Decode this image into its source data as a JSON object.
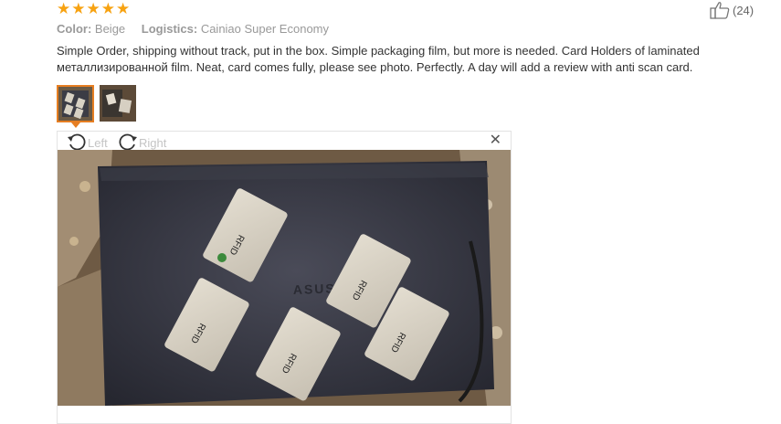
{
  "rating": {
    "stars": 5,
    "max": 5
  },
  "likes": {
    "count_text": "(24)",
    "icon": "thumbs-up-icon"
  },
  "meta": {
    "color_label": "Color:",
    "color_value": "Beige",
    "logistics_label": "Logistics:",
    "logistics_value": "Cainiao Super Economy"
  },
  "review": {
    "text": "Simple Order, shipping without track, put in the box. Simple packaging film, but more is needed. Card Holders of laminated металлизированной film. Neat, card comes fully, please see photo. Perfectly. A day will add a review with anti scan card."
  },
  "thumbnails": [
    {
      "active": true
    },
    {
      "active": false
    }
  ],
  "viewer": {
    "rotate_left_label": "Left",
    "rotate_right_label": "Right",
    "close_icon": "close-icon",
    "photo_laptop_logo": "ASUS",
    "card_label": "RFID"
  },
  "colors": {
    "star": "#f7a211",
    "accent": "#e67e22",
    "text": "#333333",
    "muted": "#999999"
  }
}
